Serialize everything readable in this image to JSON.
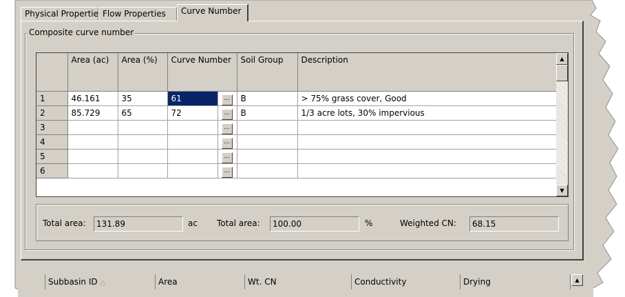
{
  "tabs": [
    "Physical Properties",
    "Flow Properties",
    "Curve Number"
  ],
  "active_tab": "Curve Number",
  "group_title": "Composite curve number",
  "table": {
    "headers": [
      "",
      "Area (ac)",
      "Area (%)",
      "Curve Number",
      "",
      "Soil Group",
      "Description"
    ],
    "rows": [
      {
        "num": "1",
        "area_ac": "46.161",
        "area_pct": "35",
        "cn": "61",
        "soil": "B",
        "desc": "> 75% grass cover, Good"
      },
      {
        "num": "2",
        "area_ac": "85.729",
        "area_pct": "65",
        "cn": "72",
        "soil": "B",
        "desc": "1/3 acre lots, 30% impervious"
      },
      {
        "num": "3",
        "area_ac": "",
        "area_pct": "",
        "cn": "",
        "soil": "",
        "desc": ""
      },
      {
        "num": "4",
        "area_ac": "",
        "area_pct": "",
        "cn": "",
        "soil": "",
        "desc": ""
      },
      {
        "num": "5",
        "area_ac": "",
        "area_pct": "",
        "cn": "",
        "soil": "",
        "desc": ""
      },
      {
        "num": "6",
        "area_ac": "",
        "area_pct": "",
        "cn": "",
        "soil": "",
        "desc": ""
      }
    ],
    "browse_label": "..."
  },
  "totals": {
    "total_area_label": "Total area:",
    "total_area_value": "131.89",
    "total_area_unit": "ac",
    "total_pct_label": "Total area:",
    "total_pct_value": "100.00",
    "total_pct_unit": "%",
    "weighted_cn_label": "Weighted CN:",
    "weighted_cn_value": "68.15"
  },
  "bottom_grid": {
    "columns": [
      "Subbasin ID",
      "Area",
      "Wt. CN",
      "Conductivity",
      "Drying"
    ]
  },
  "colors": {
    "selection": "#0a246a",
    "face": "#d4d0c8"
  }
}
